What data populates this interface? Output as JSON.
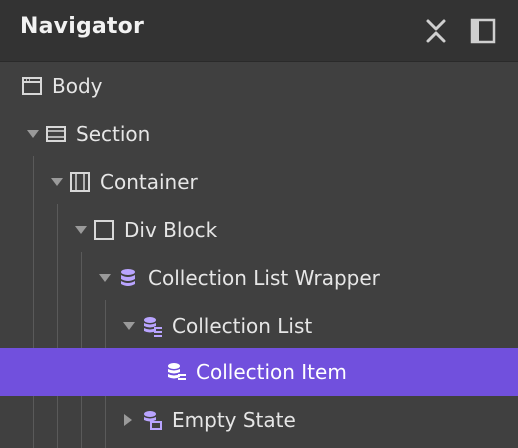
{
  "panel": {
    "title": "Navigator",
    "close_button": "close-collapse",
    "dock_button": "dock-panel"
  },
  "tree": {
    "nodes": [
      {
        "label": "Body",
        "icon": "body-icon",
        "expanded": null,
        "selected": false
      },
      {
        "label": "Section",
        "icon": "section-icon",
        "expanded": true,
        "selected": false
      },
      {
        "label": "Container",
        "icon": "container-icon",
        "expanded": true,
        "selected": false
      },
      {
        "label": "Div Block",
        "icon": "div-block-icon",
        "expanded": true,
        "selected": false
      },
      {
        "label": "Collection List Wrapper",
        "icon": "collection-wrapper-icon",
        "expanded": true,
        "selected": false
      },
      {
        "label": "Collection List",
        "icon": "collection-list-icon",
        "expanded": true,
        "selected": false
      },
      {
        "label": "Collection Item",
        "icon": "collection-item-icon",
        "expanded": null,
        "selected": true
      },
      {
        "label": "Empty State",
        "icon": "empty-state-icon",
        "expanded": false,
        "selected": false
      }
    ]
  },
  "colors": {
    "panel_bg": "#404040",
    "header_bg": "#333333",
    "selected_bg": "#7150dd",
    "collection_icon": "#b9a4ff",
    "text": "#e6e6e6"
  }
}
